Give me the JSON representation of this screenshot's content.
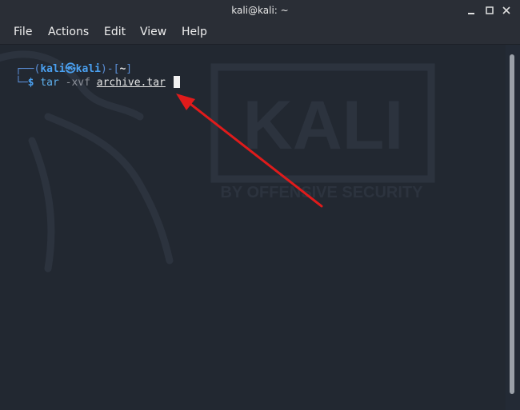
{
  "window": {
    "title": "kali@kali: ~"
  },
  "menu": {
    "items": [
      "File",
      "Actions",
      "Edit",
      "View",
      "Help"
    ]
  },
  "terminal": {
    "prompt_line_1": {
      "corner": "┌──(",
      "user": "kali",
      "at": "㉿",
      "host": "kali",
      "mid": ")-[",
      "dir": "~",
      "end": "]"
    },
    "prompt_line_2": {
      "corner": "└─",
      "symbol": "$",
      "command": "tar",
      "options": "-xvf",
      "argument": "archive.tar"
    }
  },
  "watermark": {
    "logo_text": "KALI",
    "tagline": "BY OFFENSIVE SECURITY"
  },
  "colors": {
    "background": "#222831",
    "prompt_blue": "#4aa0f0",
    "annotation_arrow": "#e01b1b"
  }
}
